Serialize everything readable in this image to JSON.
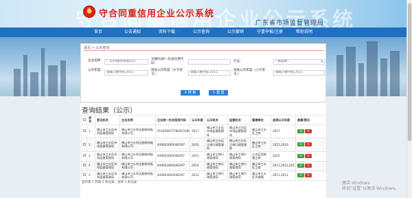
{
  "header": {
    "title": "守合同重信用企业公示系统",
    "slogan": "广东省市场监督管理局"
  },
  "nav": [
    "首页",
    "公告通知",
    "资料下载",
    "公示查询",
    "公示撤销",
    "守重申报/注册",
    "帮助说明"
  ],
  "breadcrumb": "首页 > 公示查询",
  "form": {
    "company_label": "企业名称：",
    "company_value": "广东XX服务有限公司",
    "credit_label": "注册码/统一社会信用代码：",
    "industry_label": "行业：",
    "industry_placeholder": "--请选择--",
    "year_label": "公示年度：",
    "year_placeholder": "请输入数字如 2015",
    "start_label": "连续公示年度（大于等于）：",
    "start_placeholder": "请输入数字如 2015",
    "end_label": "连续公示年度（小于等于）：",
    "end_placeholder": "请输入数字如 2015",
    "search_btn": "搜 索",
    "reset_btn": "重 置"
  },
  "results": {
    "title": "查询结果（公示）",
    "columns": [
      "",
      "序号",
      "登记机关",
      "企业名称",
      "企业统一社会信用代码",
      "公示年度",
      "公示机关",
      "监督机关",
      "管辖单位",
      "连续公示年度",
      "查看/提示"
    ],
    "rows": [
      [
        "1",
        "佛山市三水区市场监督管理局",
        "佛山市三水利达服装样板有限公司",
        "91440607578445328G",
        "2017",
        "佛山市三水区市场监督管理局",
        "佛山市三水区市场监督管理局",
        "佛山市三水区工商",
        "2017"
      ],
      [
        "2",
        "佛山市三水区市场监督管理局",
        "佛山市三水利达服装样板有限公司",
        "440603000046297",
        "2016",
        "佛山市三水区工商行政管理局",
        "佛山市三水区工商行政管理局",
        "佛山市三水区工商",
        "2015,2016"
      ],
      [
        "3",
        "佛山市三水区市场监督管理局",
        "佛山市三水利达服装样板有限公司",
        "440603000046297",
        "2015",
        "佛山市工商行政管理局",
        "佛山市工商行政管理局",
        "三水区西南镇工商",
        "2015"
      ],
      [
        "4",
        "佛山市三水区市场监督管理局",
        "佛山市三水利达服装样板有限公司",
        "440603000046297",
        "2014",
        "佛山市工商行政管理局",
        "佛山市工商行政管理局",
        "佛山市三水区工商",
        "2011,2012,2013,2014"
      ],
      [
        "5",
        "佛山市三水区市场监督管理局",
        "佛山市三水利达服装样板有限公司",
        "440603000046297",
        "2012",
        "佛山市工商行政管理局",
        "佛山市工商行政管理局",
        "佛山市三水区大塘镇",
        "2011,2012"
      ]
    ],
    "footer": "显示第 1 到第 5 条记录，总共 5 条记录"
  },
  "activate": {
    "line1": "激活 Windows",
    "line2": "转到“设置”以激活 Windows。"
  }
}
